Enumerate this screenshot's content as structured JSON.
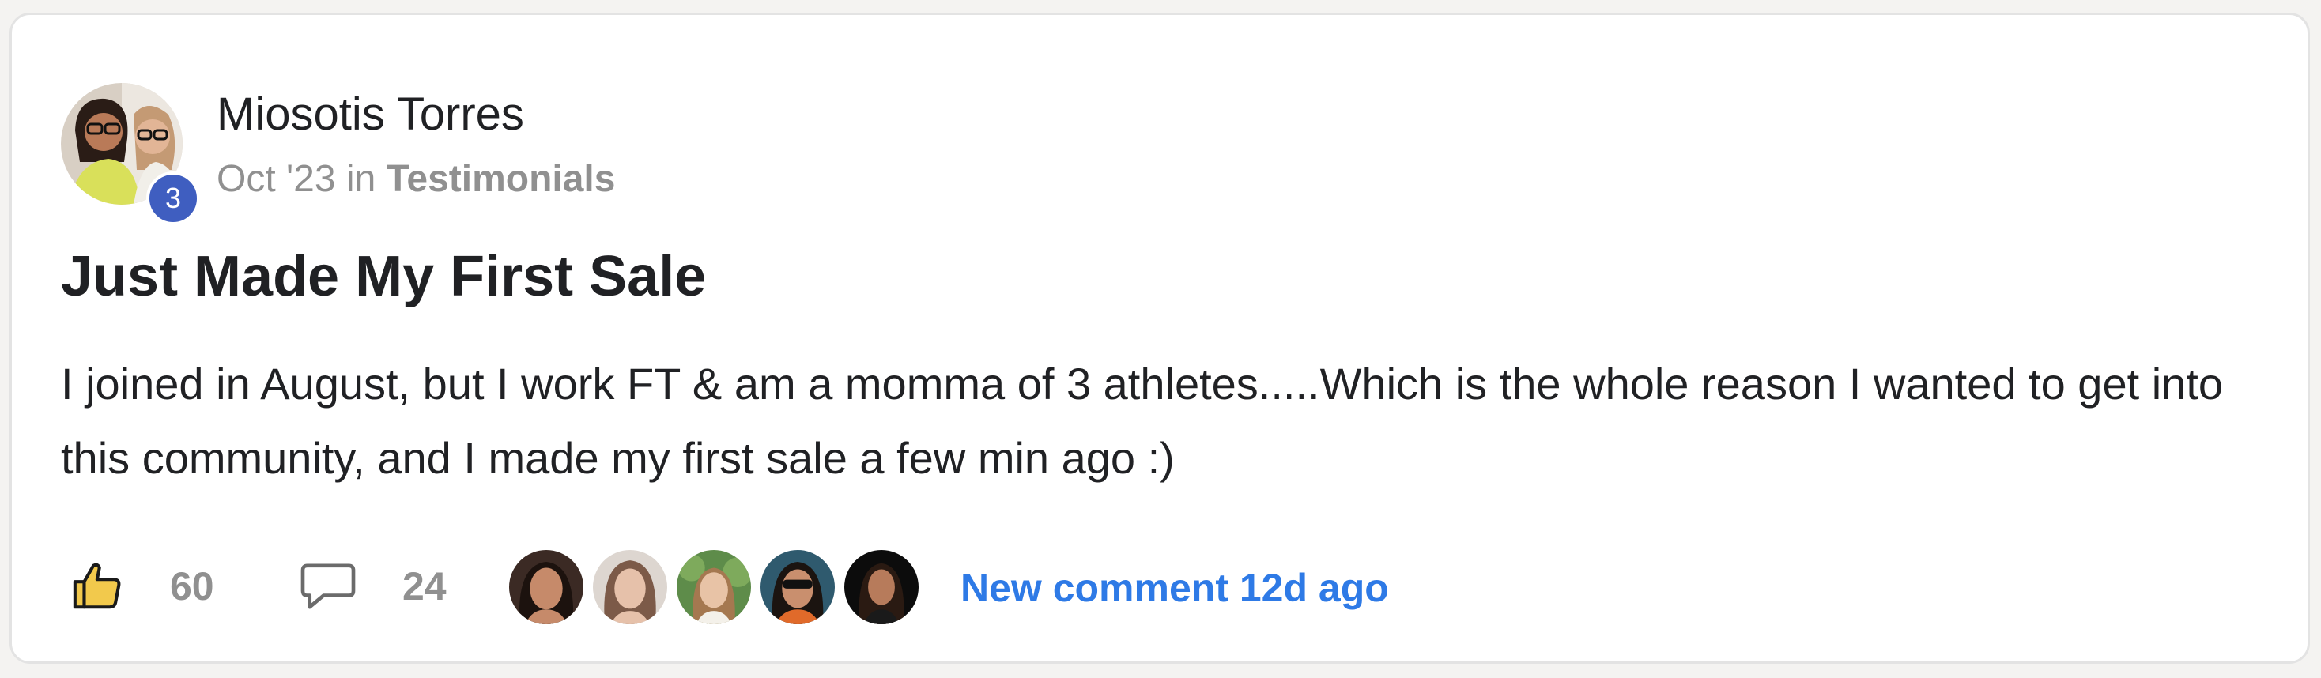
{
  "post": {
    "author": {
      "name": "Miosotis Torres",
      "level": "3"
    },
    "meta": {
      "date": "Oct '23",
      "in_word": "in",
      "category": "Testimonials"
    },
    "title": "Just Made My First Sale",
    "body": "I joined in August, but I work FT & am a momma of 3 athletes.....Which is the whole reason I wanted to get into this community, and I made my first sale a few min ago :)",
    "actions": {
      "like_icon": "thumbs-up-icon",
      "likes": "60",
      "comment_icon": "comment-bubble-icon",
      "comments": "24"
    },
    "commenter_avatars": [
      "avatar",
      "avatar",
      "avatar",
      "avatar",
      "avatar"
    ],
    "new_comment_text": "New comment 12d ago"
  },
  "colors": {
    "accent_link": "#2e7ae6",
    "level_badge": "#3f5ec0",
    "muted_text": "#909090",
    "like_icon_fill": "#f2c94c"
  }
}
